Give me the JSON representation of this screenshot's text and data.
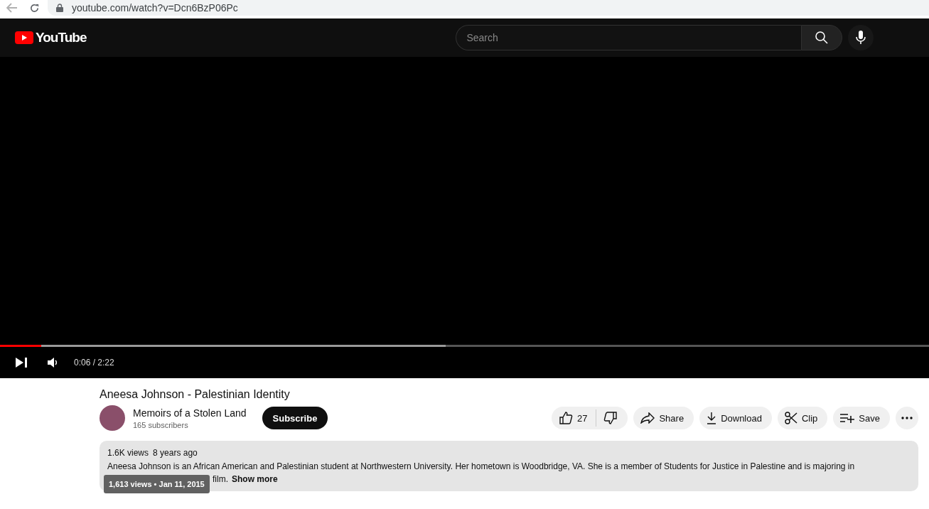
{
  "browser": {
    "url": "youtube.com/watch?v=Dcn6BzP06Pc",
    "back_disabled": true
  },
  "header": {
    "logo": "YouTube",
    "search": {
      "placeholder": "Search"
    }
  },
  "player": {
    "played": {
      "level": 0.044
    },
    "buffered": {
      "level": 0.48
    },
    "time": "0:06 / 2:22"
  },
  "video": {
    "title": "Aneesa Johnson - Palestinian Identity",
    "channel": {
      "name": "Memoirs of a Stolen Land",
      "subscribers": "165 subscribers"
    },
    "subscribe": "Subscribe",
    "actions": [
      {
        "kind": "like",
        "label": "27"
      },
      {
        "kind": "dislike"
      },
      {
        "kind": "share",
        "label": "Share"
      },
      {
        "kind": "download",
        "label": "Download"
      },
      {
        "kind": "clip",
        "label": "Clip"
      },
      {
        "kind": "save",
        "label": "Save"
      },
      {
        "kind": "more"
      }
    ]
  },
  "description": {
    "views": "1.6K views",
    "age": "8 years ago",
    "text": "Aneesa Johnson is an African American and Palestinian student at Northwestern University. Her hometown is Woodbridge, VA. She is a member of Students for Justice in Palestine and is majoring in",
    "tail": "film.",
    "show_more": "Show more",
    "tooltip": "1,613 views • Jan 11, 2015"
  }
}
